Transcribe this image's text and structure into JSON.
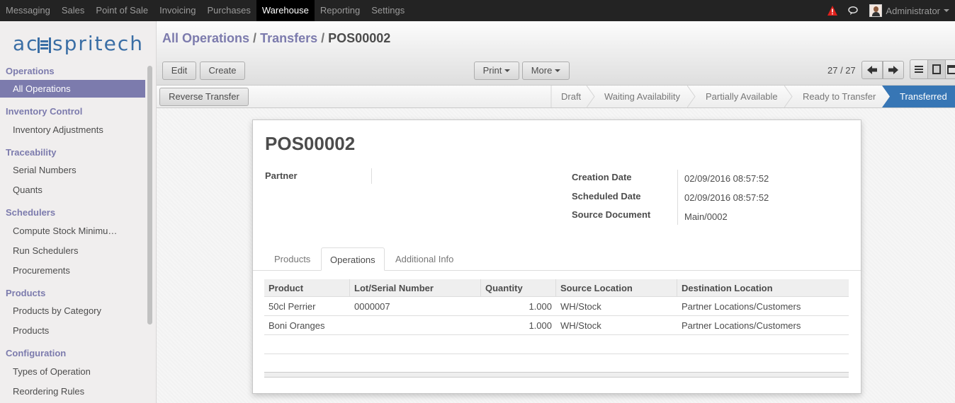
{
  "topmenu": [
    "Messaging",
    "Sales",
    "Point of Sale",
    "Invoicing",
    "Purchases",
    "Warehouse",
    "Reporting",
    "Settings"
  ],
  "active_menu": "Warehouse",
  "user": {
    "name": "Administrator"
  },
  "logo": {
    "text": "acespritech"
  },
  "sidebar": {
    "sections": [
      {
        "title": "Operations",
        "items": [
          "All Operations"
        ]
      },
      {
        "title": "Inventory Control",
        "items": [
          "Inventory Adjustments"
        ]
      },
      {
        "title": "Traceability",
        "items": [
          "Serial Numbers",
          "Quants"
        ]
      },
      {
        "title": "Schedulers",
        "items": [
          "Compute Stock Minimu…",
          "Run Schedulers",
          "Procurements"
        ]
      },
      {
        "title": "Products",
        "items": [
          "Products by Category",
          "Products"
        ]
      },
      {
        "title": "Configuration",
        "items": [
          "Types of Operation",
          "Reordering Rules"
        ]
      }
    ],
    "active_item": "All Operations"
  },
  "breadcrumb": {
    "level1": "All Operations",
    "level2": "Transfers",
    "current": "POS00002",
    "sep": "/"
  },
  "buttons": {
    "edit": "Edit",
    "create": "Create",
    "print": "Print",
    "more": "More",
    "reverse": "Reverse Transfer"
  },
  "pager": {
    "text": "27 / 27"
  },
  "statusbar": {
    "stages": [
      "Draft",
      "Waiting Availability",
      "Partially Available",
      "Ready to Transfer",
      "Transferred"
    ],
    "current": "Transferred"
  },
  "record": {
    "name": "POS00002",
    "partner_label": "Partner",
    "partner_value": "",
    "creation_date_label": "Creation Date",
    "creation_date": "02/09/2016 08:57:52",
    "scheduled_date_label": "Scheduled Date",
    "scheduled_date": "02/09/2016 08:57:52",
    "source_doc_label": "Source Document",
    "source_doc": "Main/0002"
  },
  "tabs": [
    "Products",
    "Operations",
    "Additional Info"
  ],
  "active_tab": "Operations",
  "table": {
    "headers": [
      "Product",
      "Lot/Serial Number",
      "Quantity",
      "Source Location",
      "Destination Location"
    ],
    "rows": [
      [
        "50cl Perrier",
        "0000007",
        "1.000",
        "WH/Stock",
        "Partner Locations/Customers"
      ],
      [
        "Boni Oranges",
        "",
        "1.000",
        "WH/Stock",
        "Partner Locations/Customers"
      ]
    ]
  },
  "colors": {
    "accent": "#7c7bad",
    "topbar": "#232323",
    "status_current": "#3776b5"
  }
}
